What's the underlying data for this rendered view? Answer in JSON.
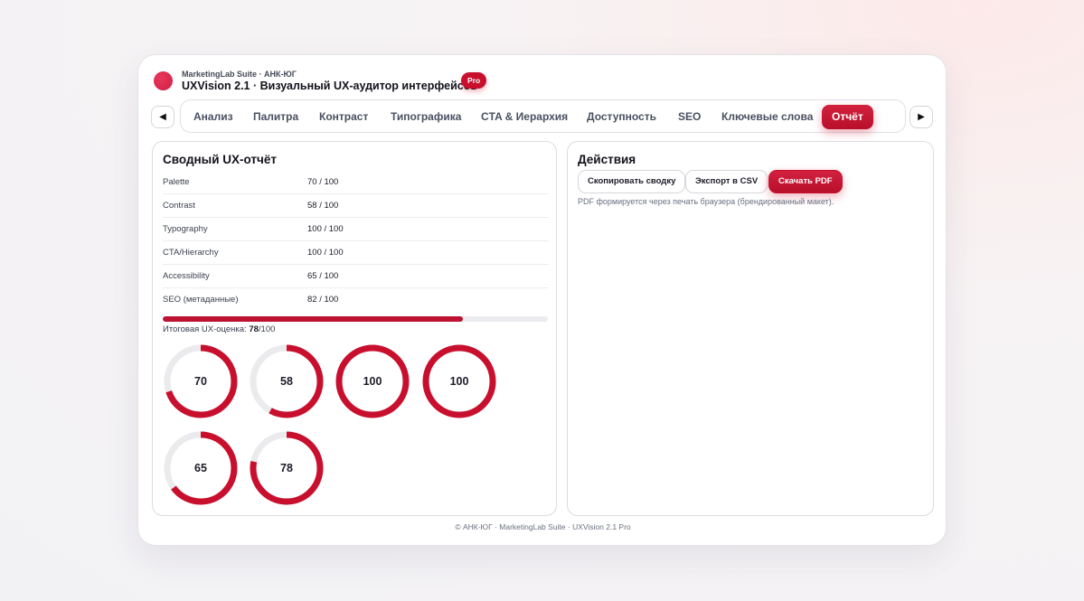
{
  "header": {
    "subtitle": "MarketingLab Suite · АНК-ЮГ",
    "title": "UXVision 2.1 · Визуальный UX-аудитор интерфейсов",
    "badge": "Pro"
  },
  "nav": {
    "prev_icon": "◀",
    "next_icon": "▶",
    "tabs": [
      {
        "label": "Анализ",
        "active": false
      },
      {
        "label": "Палитра",
        "active": false
      },
      {
        "label": "Контраст",
        "active": false
      },
      {
        "label": "Типографика",
        "active": false
      },
      {
        "label": "CTA & Иерархия",
        "active": false
      },
      {
        "label": "Доступность",
        "active": false
      },
      {
        "label": "SEO",
        "active": false
      },
      {
        "label": "Ключевые слова",
        "active": false
      },
      {
        "label": "Отчёт",
        "active": true
      }
    ]
  },
  "report": {
    "title": "Сводный UX-отчёт",
    "rows": [
      {
        "name": "Palette",
        "value": "70 / 100"
      },
      {
        "name": "Contrast",
        "value": "58 / 100"
      },
      {
        "name": "Typography",
        "value": "100 / 100"
      },
      {
        "name": "CTA/Hierarchy",
        "value": "100 / 100"
      },
      {
        "name": "Accessibility",
        "value": "65 / 100"
      },
      {
        "name": "SEO (метаданные)",
        "value": "82 / 100"
      }
    ],
    "total_label": "Итоговая UX-оценка:",
    "total_value": "78",
    "total_max": "/100",
    "total_fraction": 0.78,
    "gauges": [
      {
        "value": 70,
        "label": "70"
      },
      {
        "value": 58,
        "label": "58"
      },
      {
        "value": 100,
        "label": "100"
      },
      {
        "value": 100,
        "label": "100"
      },
      {
        "value": 65,
        "label": "65"
      },
      {
        "value": 78,
        "label": "78"
      }
    ]
  },
  "actions": {
    "title": "Действия",
    "copy_label": "Скопировать сводку",
    "csv_label": "Экспорт в CSV",
    "pdf_label": "Скачать PDF",
    "hint": "PDF формируется через печать браузера (брендированный макет)."
  },
  "footer": "© АНК-ЮГ · MarketingLab Suite · UXVision 2.1 Pro",
  "colors": {
    "accent": "#c8102e",
    "track": "#ebebee"
  }
}
